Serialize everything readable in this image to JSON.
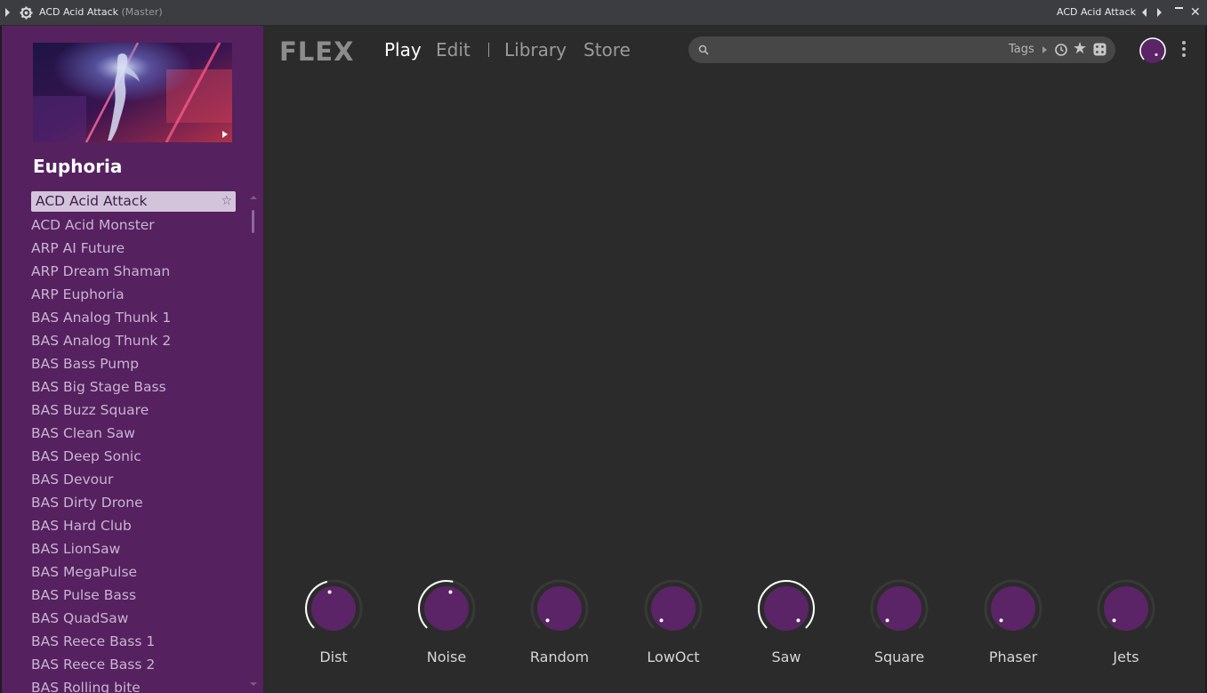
{
  "titlebar": {
    "title": "ACD Acid Attack",
    "master": "(Master)",
    "preset_name": "ACD Acid Attack"
  },
  "sidebar": {
    "pack_title": "Euphoria",
    "selected_preset": "ACD Acid Attack",
    "presets": [
      "ACD Acid Monster",
      "ARP AI Future",
      "ARP Dream Shaman",
      "ARP Euphoria",
      "BAS Analog Thunk 1",
      "BAS Analog Thunk 2",
      "BAS Bass Pump",
      "BAS Big Stage Bass",
      "BAS Buzz Square",
      "BAS Clean Saw",
      "BAS Deep Sonic",
      "BAS Devour",
      "BAS Dirty Drone",
      "BAS Hard Club",
      "BAS LionSaw",
      "BAS MegaPulse",
      "BAS Pulse Bass",
      "BAS QuadSaw",
      "BAS Reece Bass 1",
      "BAS Reece Bass 2",
      "BAS Rolling bite"
    ]
  },
  "header": {
    "logo": "FLEX",
    "nav": {
      "play": "Play",
      "edit": "Edit",
      "library": "Library",
      "store": "Store"
    },
    "search": {
      "value": "",
      "placeholder": "",
      "tags_label": "Tags"
    }
  },
  "knobs": [
    {
      "label": "Dist",
      "value": 0.45
    },
    {
      "label": "Noise",
      "value": 0.55
    },
    {
      "label": "Random",
      "value": 0.0
    },
    {
      "label": "LowOct",
      "value": 0.0
    },
    {
      "label": "Saw",
      "value": 1.0
    },
    {
      "label": "Square",
      "value": 0.0
    },
    {
      "label": "Phaser",
      "value": 0.0
    },
    {
      "label": "Jets",
      "value": 0.0
    }
  ],
  "colors": {
    "sidebar_bg": "#55215f",
    "knob_fill": "#5b2466",
    "accent": "#7a3a88"
  }
}
